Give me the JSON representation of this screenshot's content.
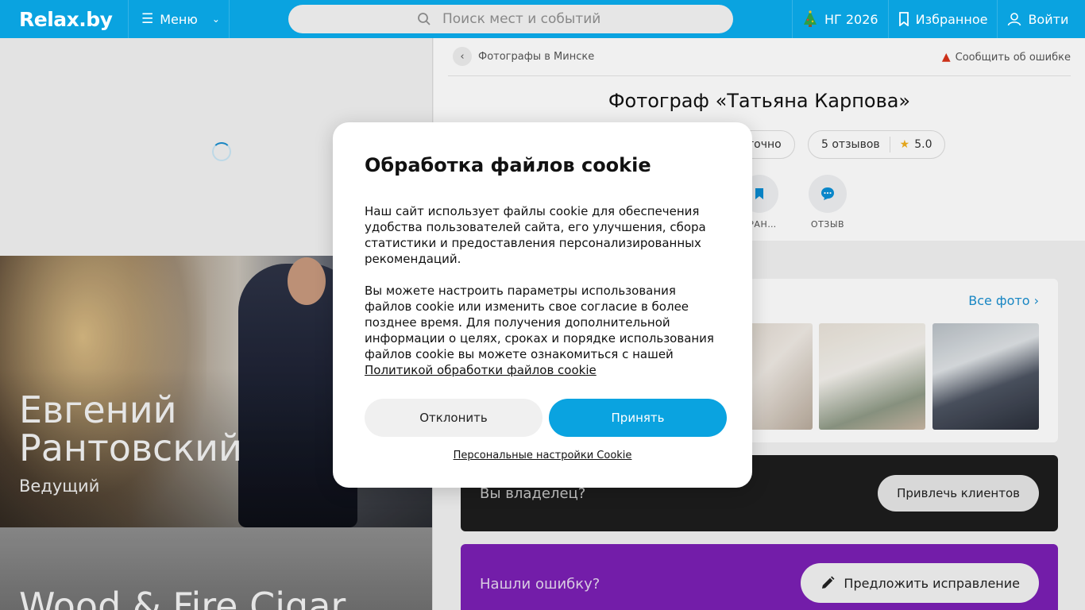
{
  "header": {
    "logo": "Relax.by",
    "menu_label": "Меню",
    "search_placeholder": "Поиск мест и событий",
    "ng_label": "НГ 2026",
    "favorites_label": "Избранное",
    "login_label": "Войти"
  },
  "left": {
    "promo1_name": "Евгений Рантовский",
    "promo1_role": "Ведущий",
    "promo2_name": "Wood & Fire Cigar"
  },
  "breadcrumb": {
    "back_link": "Фотографы в Минске",
    "report_error": "Сообщить об ошибке"
  },
  "profile": {
    "title": "Фотограф «Татьяна Карпова»",
    "status_fragment": "точно",
    "reviews_label": "5 отзывов",
    "rating": "5.0",
    "action_favorite": "БРАН…",
    "action_review": "ОТЗЫВ"
  },
  "photos": {
    "all_photos": "Все фото"
  },
  "owner": {
    "question": "Вы владелец?",
    "button": "Привлечь клиентов"
  },
  "mistake": {
    "question": "Нашли ошибку?",
    "button": "Предложить исправление"
  },
  "cookie": {
    "title": "Обработка файлов cookie",
    "paragraph1": "Наш сайт использует файлы cookie для обеспечения удобства пользователей сайта, его улучшения, сбора статистики и предоставления персонализированных рекомендаций.",
    "paragraph2": "Вы можете настроить параметры использования файлов cookie или изменить свое согласие в более позднее время. Для получения дополнительной информации о целях, сроках и порядке использования файлов cookie вы можете ознакомиться с нашей",
    "policy_link": "Политикой обработки файлов cookie",
    "decline": "Отклонить",
    "accept": "Принять",
    "personal_settings": "Персональные настройки Cookie"
  },
  "colors": {
    "brand": "#0aa3e0",
    "owner_bg": "#1d1d1d",
    "mistake_bg": "#7b1fb4"
  }
}
